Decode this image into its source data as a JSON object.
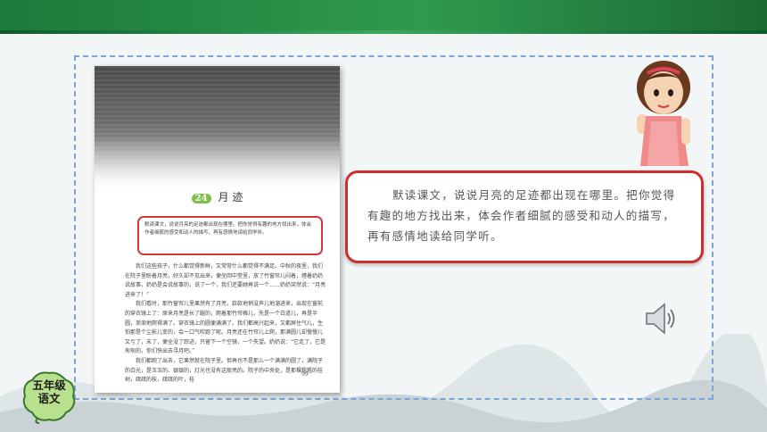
{
  "badge": {
    "line1": "五年级",
    "line2": "语文"
  },
  "textbook": {
    "lesson_number": "24",
    "lesson_title": "月 迹",
    "hint": "默读课文，说说月亮的足迹都出现在哪里。把你觉得有趣的地方找出来，体会作者细腻的感受和动人的描写，再有感情地读给同学听。",
    "paragraphs": [
      "我们这些孩子，什么都觉得新鲜，又常常什么都觉得不满足。中秋的夜里，我们在院子里盼着月亮，好久却不见出来，便坐回中堂里，放了竹窗帘儿闷着，缠着奶奶说故事。奶奶是会说故事的，说了一个，我们还要她再说一个……奶奶突然说：“月亮进来了！”",
      "我们看时，那竹窗帘儿里果然有了月亮，款款地悄没声儿地溜进来，出现在窗前的穿衣镜上了：原来月亮是长了腿的，爬着那竹帘格儿，先是一个白道儿，再是半圆，渐渐地爬得满了。穿衣镜上的圆便满满了。我们都高兴起来，又都屏住气儿，生怕那是个尘影儿变的，会一口气吹跑了呢。月亮还在竹帘儿上爬，那满圆儿却慢慢儿又亏了，末了，便全没了踪迹，只留下一个空镜，一个失望。奶奶说：“它走了，它是匆匆的，你们快出去寻月吧。”",
      "我们都跑了出去，它果然就在院子里。但再也不是那么一个满满的圆了，满院子的白光，是玉玉的、银银的，灯光也没有这般亮的。院子的中央处，是那棵粗粗的桂树，疏疏的枝，疏疏的叶，桂"
    ],
    "footnote": "本文作者贾平凹，选作课文时有改动。",
    "page_number": "99"
  },
  "hint_callout": {
    "text": "默读课文，说说月亮的足迹都出现在哪里。把你觉得有趣的地方找出来，体会作者细腻的感受和动人的描写，再有感情地读给同学听。"
  },
  "colors": {
    "header_green": "#2f9a4e",
    "frame_dash": "#7aa5d6",
    "callout_border": "#cf2e2e",
    "badge_fill": "#b9e08e"
  },
  "icons": {
    "speaker": "speaker-icon",
    "girl": "girl-illustration"
  }
}
